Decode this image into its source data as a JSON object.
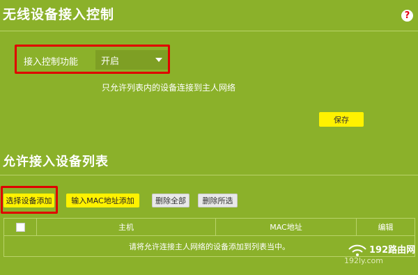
{
  "header": {
    "title": "无线设备接入控制"
  },
  "icons": {
    "help": "question-help-icon"
  },
  "access_control": {
    "label": "接入控制功能",
    "selected": "开启",
    "description": "只允许列表内的设备连接到主人网络"
  },
  "save_label": "保存",
  "device_list": {
    "title": "允许接入设备列表",
    "buttons": {
      "select_add": "选择设备添加",
      "mac_add": "输入MAC地址添加",
      "delete_all": "删除全部",
      "delete_selected": "删除所选"
    },
    "columns": {
      "host": "主机",
      "mac": "MAC地址",
      "edit": "编辑"
    },
    "empty_message": "请将允许连接主人网络的设备添加到列表当中。"
  },
  "watermark": {
    "brand": "192路由网",
    "url": "192ly.com"
  },
  "colors": {
    "background": "#8bb12a",
    "accent_button": "#fff200",
    "highlight_box": "#e00000"
  }
}
